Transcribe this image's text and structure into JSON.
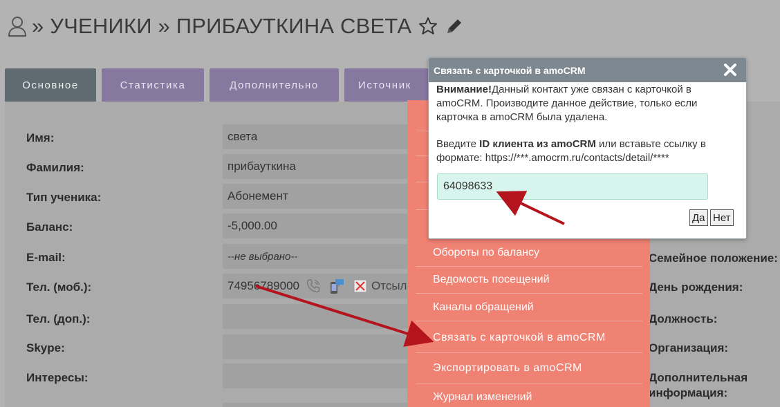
{
  "header": {
    "title": "» УЧЕНИКИ » ПРИБАУТКИНА СВЕТА"
  },
  "tabs": [
    {
      "label": "Основное",
      "active": true
    },
    {
      "label": "Статистика",
      "active": false
    },
    {
      "label": "Дополнительно",
      "active": false
    },
    {
      "label": "Источник",
      "active": false
    }
  ],
  "form": {
    "rows": [
      {
        "label": "Имя:",
        "value": "света"
      },
      {
        "label": "Фамилия:",
        "value": "прибауткина"
      },
      {
        "label": "Тип ученика:",
        "value": "Абонемент"
      },
      {
        "label": "Баланс:",
        "value": "-5,000.00"
      },
      {
        "label": "E-mail:",
        "value": "--не выбрано--"
      },
      {
        "label": "Тел. (моб.):",
        "value": "74956789000",
        "extra": "Отсыл"
      },
      {
        "label": "Тел. (доп.):",
        "value": ""
      },
      {
        "label": "Skype:",
        "value": ""
      },
      {
        "label": "Интересы:",
        "value": ""
      }
    ],
    "right_labels": [
      "Семейное положение:",
      "День рождения:",
      "Должность:",
      "Организация:",
      "Дополнительная информация:"
    ]
  },
  "menu": {
    "items": [
      "Обороты по балансу",
      "Ведомость посещений",
      "Каналы обращений",
      "Связать с карточкой в amoCRM",
      "Экспортировать в amoCRM",
      "Журнал изменений"
    ]
  },
  "dialog": {
    "title": "Связать с карточкой в amoCRM",
    "warning_bold": "Внимание!",
    "warning_text": "Данный контакт уже связан с карточкой в amoCRM. Производите данное действие, только если карточка в amoCRM была удалена.",
    "prompt_prefix": "Введите ",
    "prompt_bold": "ID клиента из amoCRM",
    "prompt_suffix": " или вставьте ссылку в формате: https://***.amocrm.ru/contacts/detail/****",
    "input_value": "64098633",
    "yes_label": "Да",
    "no_label": "Нет"
  },
  "colors": {
    "tab_active": "#5f6a71",
    "tab_inactive": "#86789e",
    "menu_bg": "#f08274",
    "input_bg": "#d8f5ed",
    "arrow": "#b4141e"
  },
  "icons": [
    "user-icon",
    "star-icon",
    "pencil-icon",
    "phone-call-icon",
    "sms-icon",
    "blocked-icon",
    "close-icon"
  ]
}
